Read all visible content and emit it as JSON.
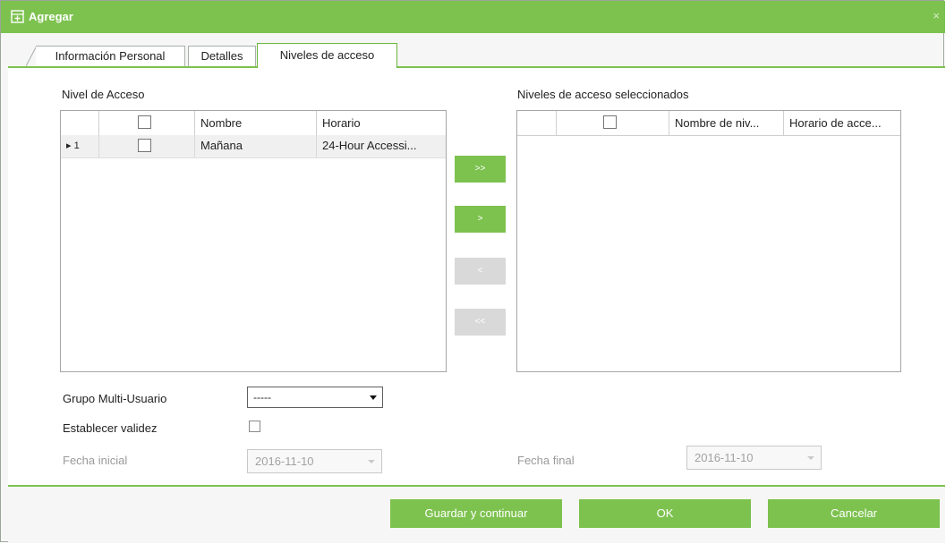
{
  "window": {
    "title": "Agregar",
    "close_glyph": "×",
    "icon": "add-form-icon",
    "accent_color": "#7dc24f"
  },
  "tabs": [
    {
      "label": "Información Personal",
      "active": false
    },
    {
      "label": "Detalles",
      "active": false
    },
    {
      "label": "Niveles de acceso",
      "active": true
    }
  ],
  "left_panel": {
    "title": "Nivel de Acceso",
    "columns": [
      "",
      "",
      "Nombre",
      "Horario"
    ],
    "rows": [
      {
        "marker": "▸",
        "index": "1",
        "checked": false,
        "name": "Mañana",
        "schedule": "24-Hour Accessi..."
      }
    ]
  },
  "right_panel": {
    "title": "Niveles de acceso seleccionados",
    "columns": [
      "",
      "",
      "Nombre de niv...",
      "Horario de acce..."
    ],
    "rows": []
  },
  "movers": [
    {
      "label": ">>",
      "enabled": true
    },
    {
      "label": ">",
      "enabled": true
    },
    {
      "label": "<",
      "enabled": false
    },
    {
      "label": "<<",
      "enabled": false
    }
  ],
  "form": {
    "multi_user_label": "Grupo Multi-Usuario",
    "multi_user_value": "-----",
    "validity_label": "Establecer validez",
    "validity_checked": false,
    "start_label": "Fecha inicial",
    "start_value": "2016-11-10",
    "end_label": "Fecha final",
    "end_value": "2016-11-10"
  },
  "buttons": {
    "save_continue": "Guardar y continuar",
    "ok": "OK",
    "cancel": "Cancelar"
  }
}
